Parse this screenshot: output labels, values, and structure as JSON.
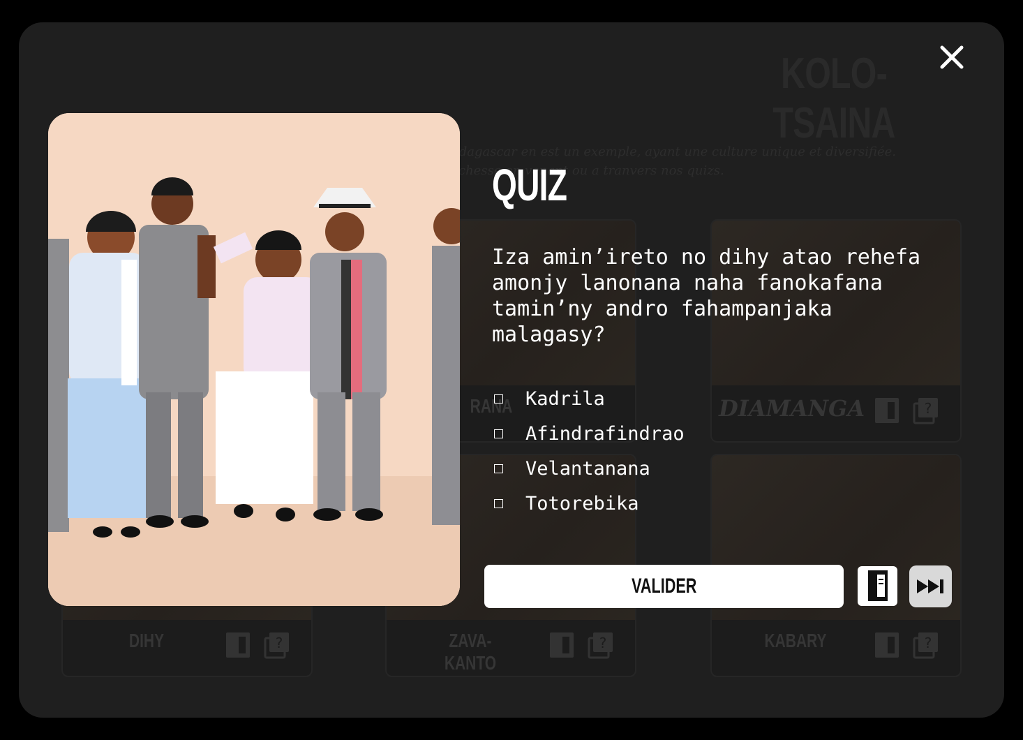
{
  "background_page": {
    "title": "KOLO-TSAINA",
    "intro_line1": "adagascar en est un exemple, ayant une culture unique et diversifiée.",
    "intro_line2": "chesse en venant ou a tranvers nos quizs.",
    "cards": [
      {
        "label": "RANA"
      },
      {
        "label": "DIAMANGA"
      },
      {
        "label": "DIHY"
      },
      {
        "label": "ZAVA-KANTO"
      },
      {
        "label": "KABARY"
      }
    ]
  },
  "quiz": {
    "title": "QUIZ",
    "question": "Iza amin’ireto no dihy atao rehefa amonjy lanonana naha fanokafana tamin’ny andro fahampanjaka malagasy?",
    "options": [
      {
        "label": "Kadrila"
      },
      {
        "label": "Afindrafindrao"
      },
      {
        "label": "Velantanana"
      },
      {
        "label": "Totorebika"
      }
    ],
    "validate_label": "VALIDER",
    "icons": {
      "close": "close-icon",
      "document": "document-icon",
      "skip": "skip-next-icon"
    }
  },
  "colors": {
    "backdrop": "#000000",
    "panel": "#1f1f1f",
    "text": "#ffffff",
    "button": "#ffffff",
    "skip_button": "#d9d9d9"
  }
}
